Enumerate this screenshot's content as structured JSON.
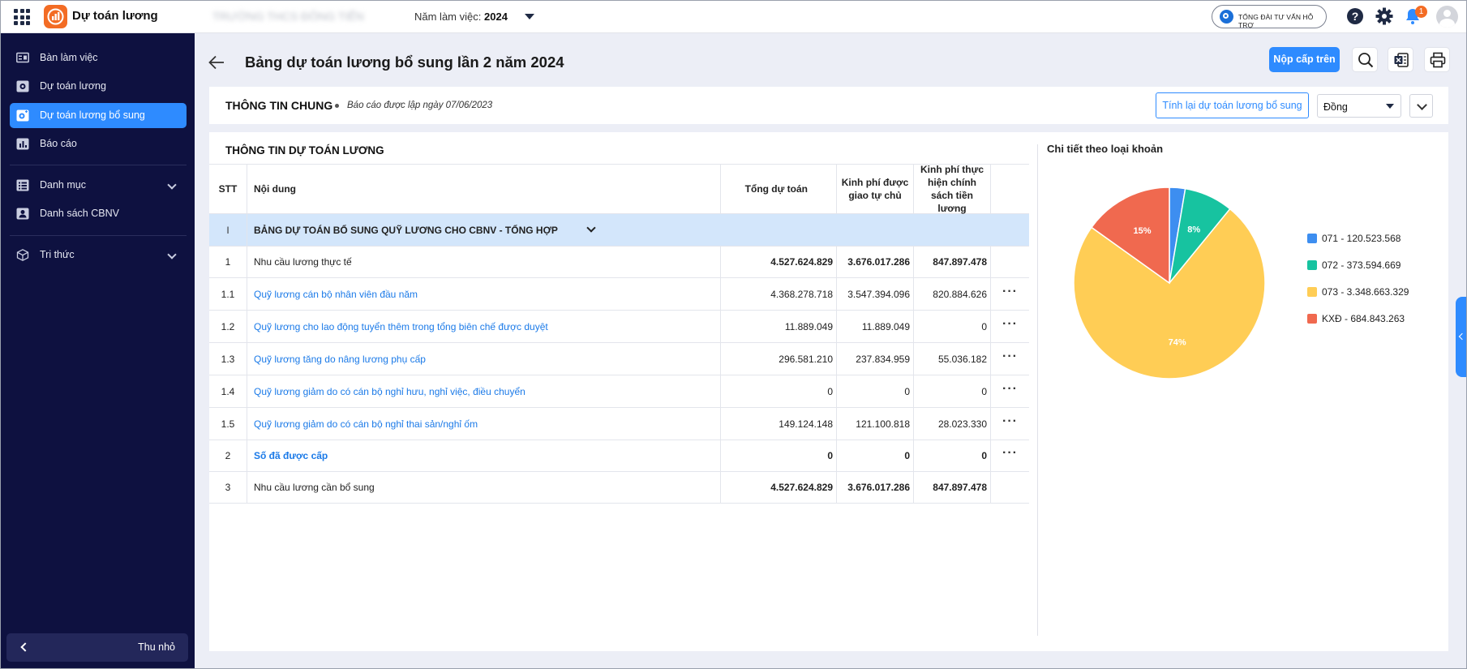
{
  "app": {
    "title": "Dự toán lương",
    "org_name": "TRƯỜNG THCS ĐÔNG TIẾN",
    "year_label": "Năm làm việc:",
    "year_value": "2024",
    "hotline": "TỔNG ĐÀI TƯ VẤN HỖ TRỢ",
    "notification_count": "1"
  },
  "sidebar": {
    "items": [
      {
        "label": "Bàn làm việc",
        "icon": "desk-icon"
      },
      {
        "label": "Dự toán lương",
        "icon": "budget-icon"
      },
      {
        "label": "Dự toán lương bổ sung",
        "icon": "budget-plus-icon",
        "active": true
      },
      {
        "label": "Báo cáo",
        "icon": "report-icon"
      },
      {
        "label": "Danh mục",
        "icon": "list-icon",
        "expandable": true
      },
      {
        "label": "Danh sách CBNV",
        "icon": "staff-icon"
      },
      {
        "label": "Tri thức",
        "icon": "knowledge-icon",
        "expandable": true
      }
    ],
    "collapse_label": "Thu nhỏ"
  },
  "page": {
    "title": "Bảng dự toán lương bổ sung lần 2 năm 2024",
    "submit_label": "Nộp cấp trên"
  },
  "info": {
    "title": "THÔNG TIN CHUNG",
    "date_note": "Báo cáo được lập ngày 07/06/2023",
    "recalc_label": "Tính lại dự toán lương bổ sung",
    "unit": "Đồng"
  },
  "table": {
    "title": "THÔNG TIN DỰ TOÁN LƯƠNG",
    "headers": {
      "stt": "STT",
      "content": "Nội dung",
      "total": "Tổng dự toán",
      "self": "Kinh phí được giao tự chủ",
      "policy": "Kinh phí thực hiện chính sách tiền lương"
    },
    "group": {
      "stt": "I",
      "content": "BẢNG DỰ TOÁN BỔ SUNG QUỸ LƯƠNG CHO CBNV - TỔNG HỢP"
    },
    "rows": [
      {
        "stt": "1",
        "content": "Nhu cầu lương thực tế",
        "total": "4.527.624.829",
        "self": "3.676.017.286",
        "policy": "847.897.478"
      },
      {
        "stt": "1.1",
        "content": "Quỹ lương cán bộ nhân viên đầu năm",
        "total": "4.368.278.718",
        "self": "3.547.394.096",
        "policy": "820.884.626",
        "actions": "···"
      },
      {
        "stt": "1.2",
        "content": "Quỹ lương cho lao động tuyển thêm trong tổng biên chế được duyệt",
        "total": "11.889.049",
        "self": "11.889.049",
        "policy": "0",
        "actions": "···"
      },
      {
        "stt": "1.3",
        "content": "Quỹ lương tăng do nâng lương phụ cấp",
        "total": "296.581.210",
        "self": "237.834.959",
        "policy": "55.036.182",
        "actions": "···"
      },
      {
        "stt": "1.4",
        "content": "Quỹ lương giảm do có cán bộ nghỉ hưu, nghỉ việc, điều chuyển",
        "total": "0",
        "self": "0",
        "policy": "0",
        "actions": "···"
      },
      {
        "stt": "1.5",
        "content": "Quỹ lương giảm do có cán bộ nghỉ thai sản/nghỉ ốm",
        "total": "149.124.148",
        "self": "121.100.818",
        "policy": "28.023.330",
        "actions": "···"
      },
      {
        "stt": "2",
        "content": "Số đã được cấp",
        "total": "0",
        "self": "0",
        "policy": "0",
        "actions": "···"
      },
      {
        "stt": "3",
        "content": "Nhu cầu lương cần bổ sung",
        "total": "4.527.624.829",
        "self": "3.676.017.286",
        "policy": "847.897.478"
      }
    ]
  },
  "chart_data": {
    "type": "pie",
    "title": "Chi tiết theo loại khoản",
    "categories": [
      "071 - 120.523.568",
      "072 - 373.594.669",
      "073 - 3.348.663.329",
      "KXĐ - 684.843.263"
    ],
    "values": [
      120523568,
      373594669,
      3348663329,
      684843263
    ],
    "percent_labels": [
      "",
      "8%",
      "74%",
      "15%"
    ],
    "colors": [
      "#3d8ef0",
      "#17c3a0",
      "#ffcd55",
      "#f0694f"
    ],
    "legend": "right"
  }
}
